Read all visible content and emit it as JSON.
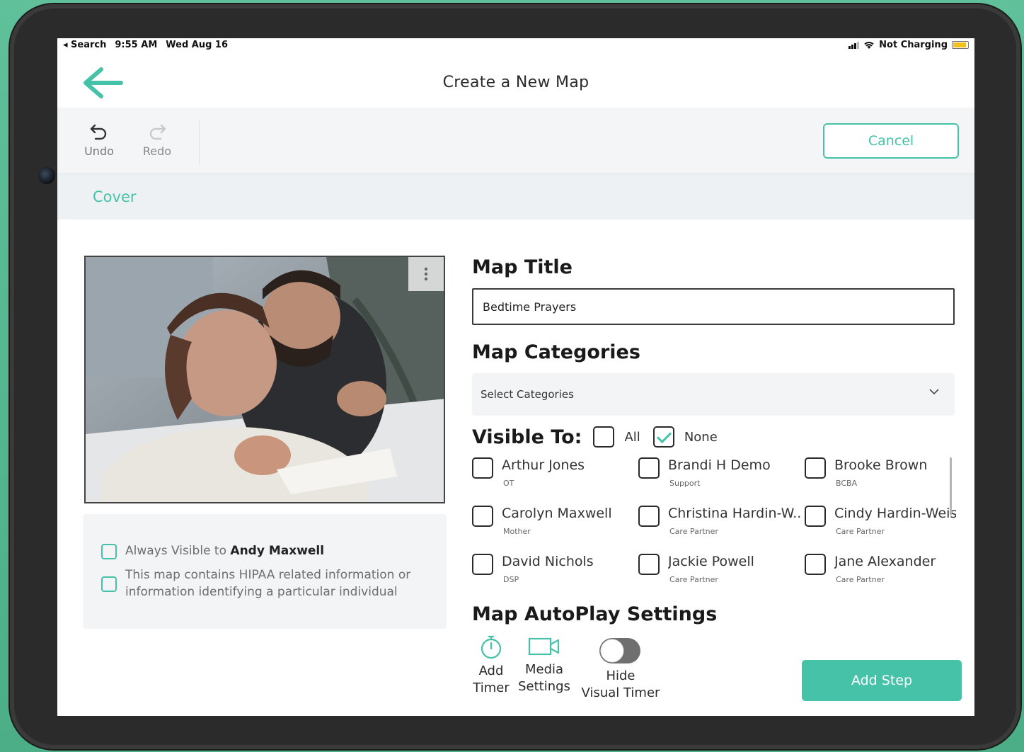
{
  "status_bar": {
    "back_app": "◂ Search",
    "time": "9:55 AM",
    "date": "Wed Aug 16",
    "battery_status": "Not Charging"
  },
  "header": {
    "title": "Create a New Map",
    "back_icon": "arrow-left-icon"
  },
  "toolbar": {
    "undo_label": "Undo",
    "redo_label": "Redo",
    "cancel_label": "Cancel"
  },
  "tabs": {
    "active": "Cover"
  },
  "cover": {
    "image_icon": "more-vertical-icon",
    "always_visible_prefix": "Always Visible to ",
    "always_visible_name": "Andy Maxwell",
    "hipaa_text": "This map contains HIPAA related information or information identifying a particular individual"
  },
  "form": {
    "map_title_heading": "Map Title",
    "map_title_value": "Bedtime Prayers",
    "categories_heading": "Map Categories",
    "categories_placeholder": "Select Categories",
    "visible_to_label": "Visible To:",
    "all_label": "All",
    "none_label": "None",
    "none_checked": true,
    "all_checked": false
  },
  "people": [
    {
      "name": "Arthur Jones",
      "role": "OT"
    },
    {
      "name": "Brandi H Demo",
      "role": "Support"
    },
    {
      "name": "Brooke Brown",
      "role": "BCBA"
    },
    {
      "name": "Carolyn Maxwell",
      "role": "Mother"
    },
    {
      "name": "Christina Hardin-W...",
      "role": "Care Partner"
    },
    {
      "name": "Cindy Hardin-Weis.",
      "role": "Care Partner"
    },
    {
      "name": "David Nichols",
      "role": "DSP"
    },
    {
      "name": "Jackie Powell",
      "role": "Care Partner"
    },
    {
      "name": "Jane Alexander",
      "role": "Care Partner"
    }
  ],
  "autoplay": {
    "heading": "Map AutoPlay Settings",
    "add_timer_line1": "Add",
    "add_timer_line2": "Timer",
    "media_line1": "Media",
    "media_line2": "Settings",
    "hide_line1": "Hide",
    "hide_line2": "Visual Timer",
    "hide_toggle_on": false
  },
  "actions": {
    "add_step_label": "Add Step"
  },
  "colors": {
    "accent": "#46c2a8",
    "background_green": "#5fc09a"
  }
}
